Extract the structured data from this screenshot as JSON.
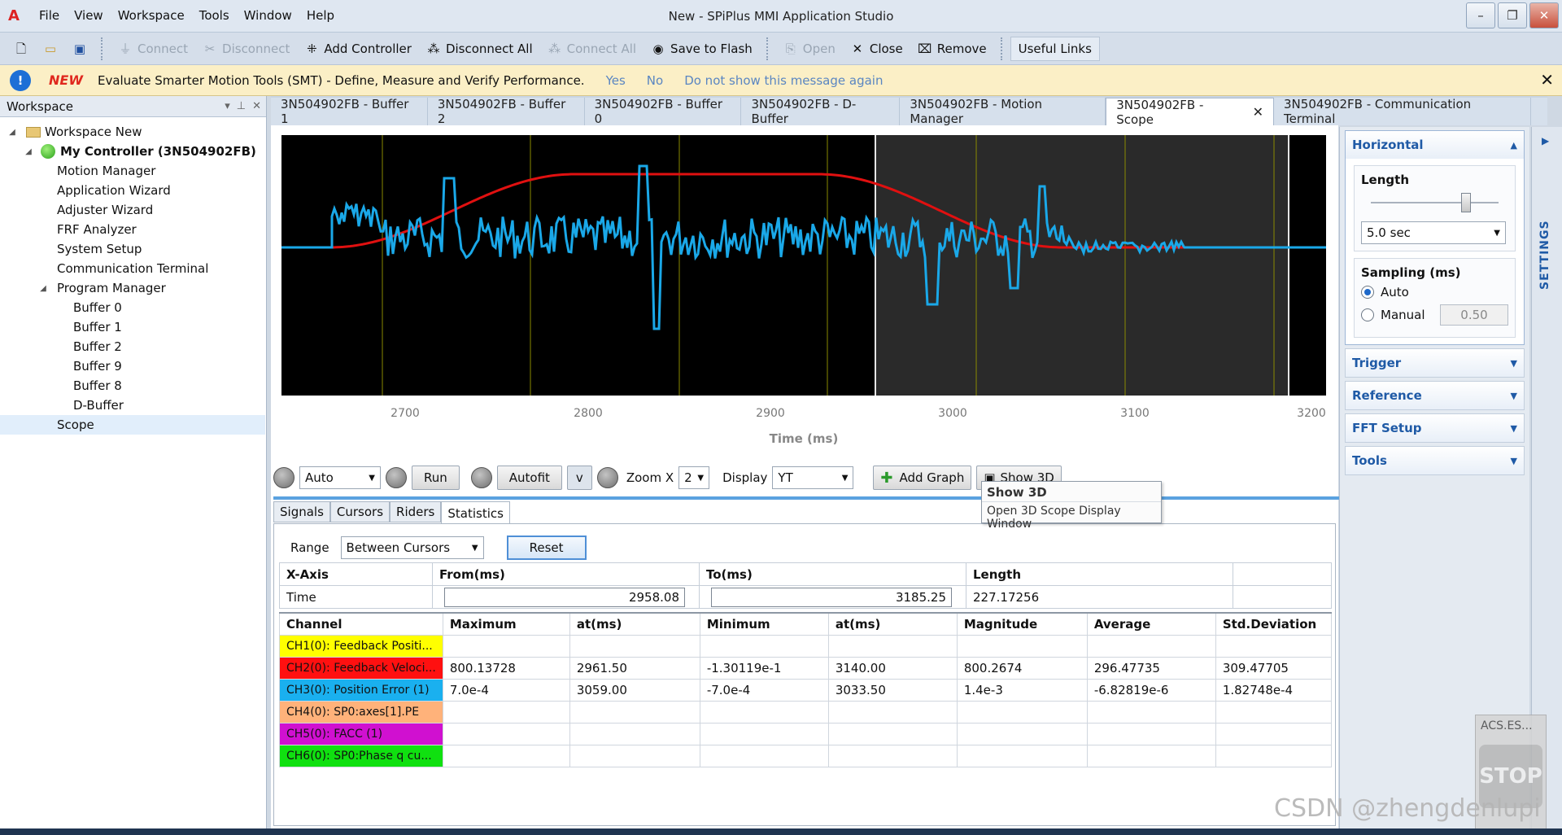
{
  "app": {
    "logo": "A",
    "title": "New - SPiPlus MMI Application Studio"
  },
  "menu": [
    "File",
    "View",
    "Workspace",
    "Tools",
    "Window",
    "Help"
  ],
  "window_buttons": [
    "minimize-icon",
    "restore-icon",
    "close-icon"
  ],
  "toolbar": {
    "connect": "Connect",
    "disconnect": "Disconnect",
    "add_controller": "Add Controller",
    "disconnect_all": "Disconnect All",
    "connect_all": "Connect All",
    "save_to_flash": "Save to Flash",
    "open": "Open",
    "close": "Close",
    "remove": "Remove",
    "useful_links": "Useful Links"
  },
  "infobar": {
    "badge": "NEW",
    "message": "Evaluate Smarter Motion Tools (SMT) - Define, Measure and Verify Performance.",
    "yes": "Yes",
    "no": "No",
    "dont_show": "Do not show this message again"
  },
  "workspace": {
    "title": "Workspace",
    "root": "Workspace New",
    "controller": "My Controller (3N504902FB)",
    "items": [
      "Motion Manager",
      "Application Wizard",
      "Adjuster Wizard",
      "FRF Analyzer",
      "System Setup",
      "Communication Terminal"
    ],
    "program_manager": "Program Manager",
    "buffers": [
      "Buffer 0",
      "Buffer 1",
      "Buffer 2",
      "Buffer 9",
      "Buffer 8",
      "D-Buffer"
    ],
    "scope": "Scope"
  },
  "doc_tabs": [
    "3N504902FB - Buffer 1",
    "3N504902FB - Buffer 2",
    "3N504902FB - Buffer 0",
    "3N504902FB - D-Buffer",
    "3N504902FB - Motion Manager",
    "3N504902FB - Scope",
    "3N504902FB - Communication Terminal"
  ],
  "plot": {
    "x_ticks": [
      "2700",
      "2800",
      "2900",
      "3000",
      "3100",
      "3200"
    ],
    "x_label": "Time (ms)",
    "colors": {
      "red": "#e01010",
      "blue": "#1aa8e8",
      "grid": "#8a8a00"
    }
  },
  "controls": {
    "mode": "Auto",
    "run": "Run",
    "autofit": "Autofit",
    "v": "v",
    "zoom_label": "Zoom X",
    "zoom_value": "2",
    "display_label": "Display",
    "display_value": "YT",
    "add_graph": "Add Graph",
    "show_3d": "Show 3D"
  },
  "tooltip": {
    "title": "Show 3D",
    "body": "Open 3D Scope Display Window"
  },
  "sub_tabs": [
    "Signals",
    "Cursors",
    "Riders",
    "Statistics"
  ],
  "stats": {
    "range_label": "Range",
    "range_value": "Between Cursors",
    "reset": "Reset",
    "xaxis_headers": [
      "X-Axis",
      "From(ms)",
      "To(ms)",
      "Length"
    ],
    "time_label": "Time",
    "from": "2958.08",
    "to": "3185.25",
    "length": "227.17256",
    "headers": [
      "Channel",
      "Maximum",
      "at(ms)",
      "Minimum",
      "at(ms)",
      "Magnitude",
      "Average",
      "Std.Deviation"
    ],
    "rows": [
      {
        "name": "CH1(0): Feedback Positi...",
        "color": "#ffff00",
        "cells": [
          "",
          "",
          "",
          "",
          "",
          "",
          ""
        ]
      },
      {
        "name": "CH2(0): Feedback Veloci...",
        "color": "#ff1010",
        "cells": [
          "800.13728",
          "2961.50",
          "-1.30119e-1",
          "3140.00",
          "800.2674",
          "296.47735",
          "309.47705"
        ]
      },
      {
        "name": "CH3(0): Position Error (1)",
        "color": "#1ab0ef",
        "cells": [
          "7.0e-4",
          "3059.00",
          "-7.0e-4",
          "3033.50",
          "1.4e-3",
          "-6.82819e-6",
          "1.82748e-4"
        ]
      },
      {
        "name": "CH4(0): SP0:axes[1].PE",
        "color": "#ffb27a",
        "cells": [
          "",
          "",
          "",
          "",
          "",
          "",
          ""
        ]
      },
      {
        "name": "CH5(0): FACC (1)",
        "color": "#d010d0",
        "cells": [
          "",
          "",
          "",
          "",
          "",
          "",
          ""
        ]
      },
      {
        "name": "CH6(0): SP0:Phase q cu...",
        "color": "#10e010",
        "cells": [
          "",
          "",
          "",
          "",
          "",
          "",
          ""
        ]
      }
    ]
  },
  "right_panel": {
    "horizontal": "Horizontal",
    "length_label": "Length",
    "length_value": "5.0 sec",
    "sampling_label": "Sampling (ms)",
    "auto": "Auto",
    "manual": "Manual",
    "manual_value": "0.50",
    "trigger": "Trigger",
    "reference": "Reference",
    "fft": "FFT Setup",
    "tools": "Tools",
    "settings_tab": "SETTINGS"
  },
  "stop_widget": {
    "title": "ACS.ES...",
    "label": "STOP"
  },
  "watermark": "CSDN @zhengdenlupi"
}
